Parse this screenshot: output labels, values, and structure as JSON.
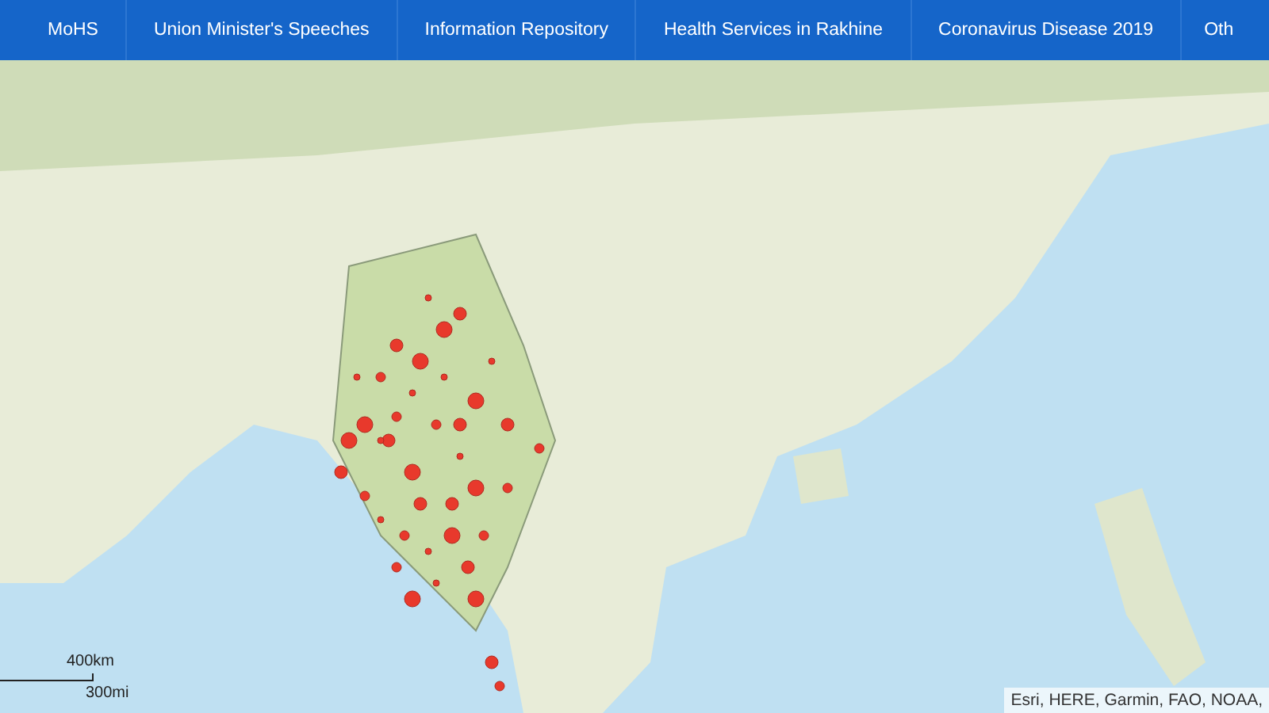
{
  "nav": {
    "items": [
      {
        "label": "MoHS"
      },
      {
        "label": "Union Minister's Speeches"
      },
      {
        "label": "Information Repository"
      },
      {
        "label": "Health Services in Rakhine"
      },
      {
        "label": "Coronavirus Disease 2019"
      },
      {
        "label": "Oth"
      }
    ]
  },
  "map": {
    "scale": {
      "metric": "400km",
      "imperial": "300mi"
    },
    "attribution": "Esri, HERE, Garmin, FAO, NOAA,"
  }
}
